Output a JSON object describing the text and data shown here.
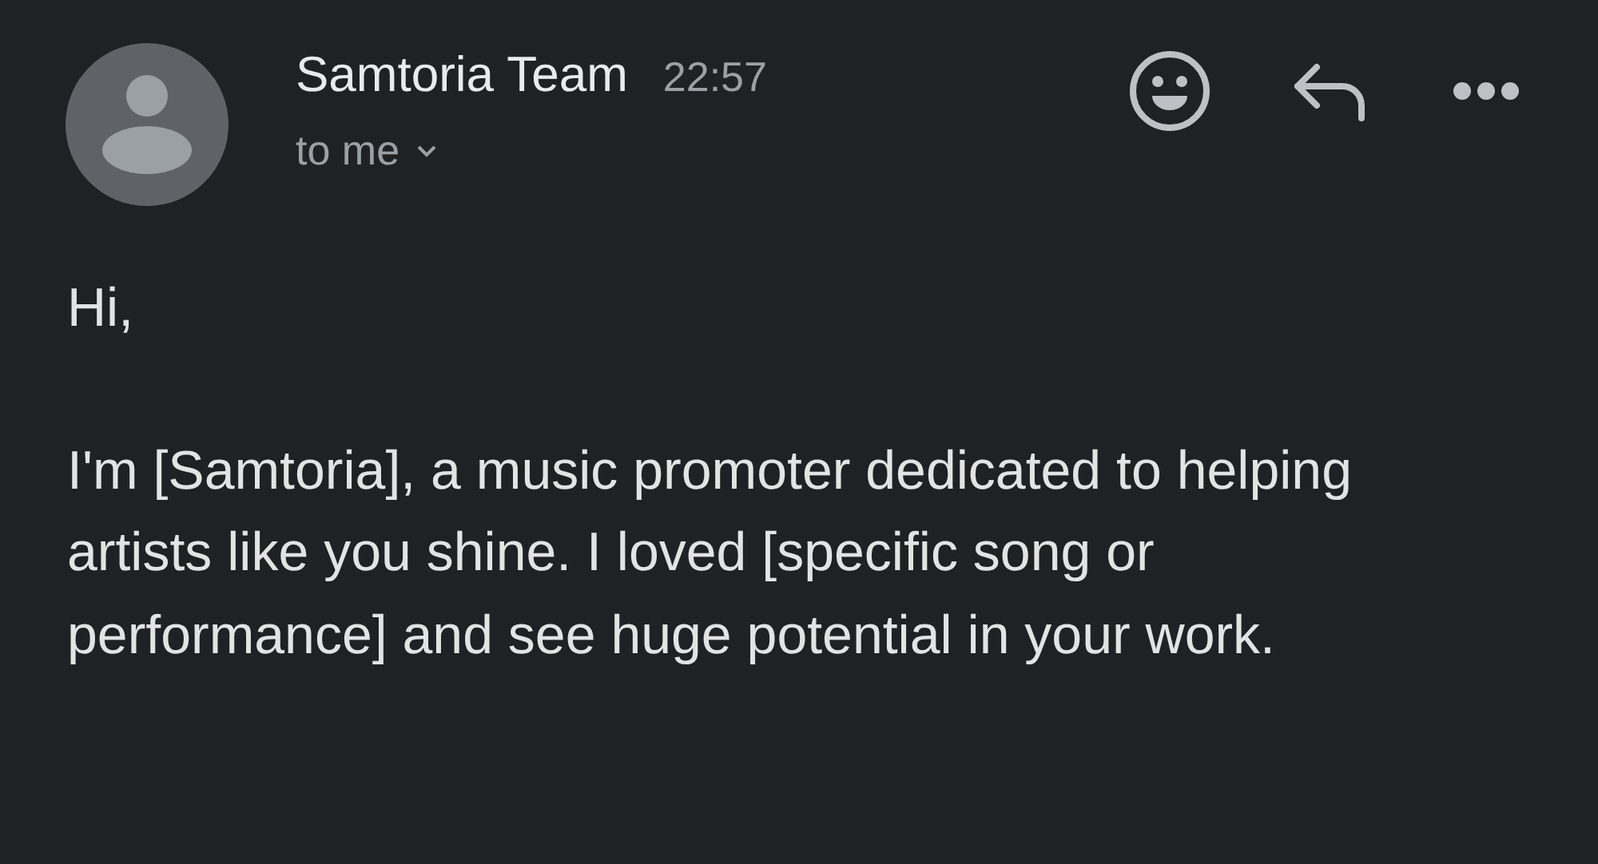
{
  "message": {
    "sender": "Samtoria Team",
    "time": "22:57",
    "recipient": "to me",
    "body": [
      "Hi,",
      "I'm [Samtoria], a music promoter dedicated to helping artists like you shine. I loved [specific song or performance] and see huge potential in your work."
    ]
  }
}
